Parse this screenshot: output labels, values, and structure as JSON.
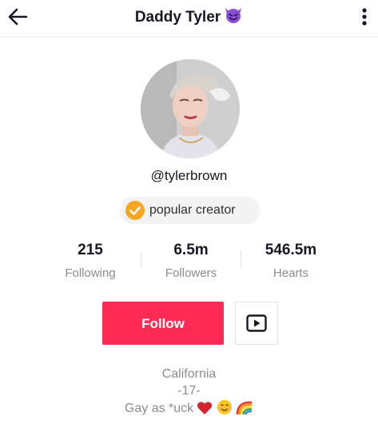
{
  "header": {
    "title": "Daddy Tyler",
    "title_emoji": "smiling-devil",
    "back_icon": "arrow-left-icon",
    "more_icon": "more-vertical-icon"
  },
  "profile": {
    "username": "@tylerbrown",
    "badge_label": "popular creator",
    "badge_color": "#f6a623"
  },
  "stats": [
    {
      "value": "215",
      "label": "Following"
    },
    {
      "value": "6.5m",
      "label": "Followers"
    },
    {
      "value": "546.5m",
      "label": "Hearts"
    }
  ],
  "actions": {
    "follow_label": "Follow",
    "follow_color": "#fe2c55",
    "video_icon": "youtube-icon"
  },
  "bio": {
    "line1": "California",
    "line2": "-17-",
    "line3": "Gay as *uck",
    "line3_emojis": [
      "red-heart",
      "smiling-face",
      "rainbow"
    ]
  }
}
